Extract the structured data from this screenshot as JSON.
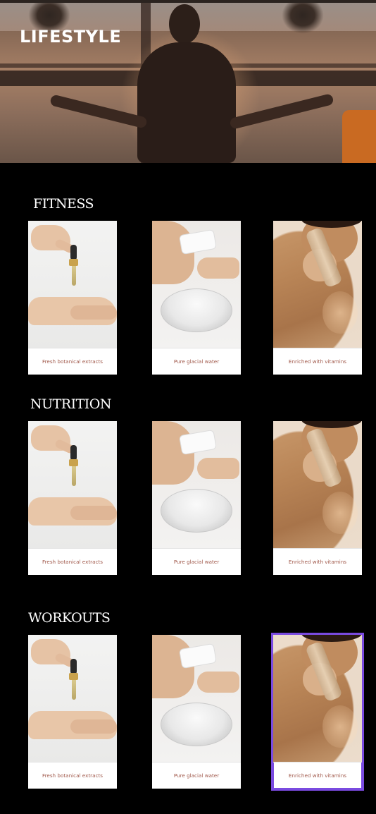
{
  "hero": {
    "title": "LIFESTYLE"
  },
  "sections": [
    {
      "title": "FITNESS",
      "cards": [
        {
          "caption": "Fresh botanical extracts"
        },
        {
          "caption": "Pure glacial water"
        },
        {
          "caption": "Enriched with vitamins"
        }
      ]
    },
    {
      "title": "NUTRITION",
      "cards": [
        {
          "caption": "Fresh botanical extracts"
        },
        {
          "caption": "Pure glacial water"
        },
        {
          "caption": "Enriched with vitamins"
        }
      ]
    },
    {
      "title": "WORKOUTS",
      "cards": [
        {
          "caption": "Fresh botanical extracts"
        },
        {
          "caption": "Pure glacial water"
        },
        {
          "caption": "Enriched with vitamins"
        }
      ]
    }
  ],
  "colors": {
    "background": "#000000",
    "caption": "#a0584a",
    "selection": "#7a4be0"
  }
}
